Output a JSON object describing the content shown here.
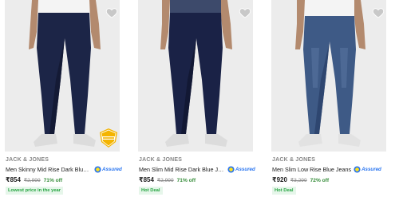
{
  "products": [
    {
      "brand": "JACK & JONES",
      "title": "Men Skinny Mid Rise Dark Blue ...",
      "price": "₹854",
      "mrp": "₹2,999",
      "discount": "71% off",
      "tag": "Lowest price in the year",
      "assured": "Assured",
      "badge_text": "BRAND AUTHORITY VALUE",
      "jeans_color": "#1c2547",
      "jeans_shade": "#141a35"
    },
    {
      "brand": "JACK & JONES",
      "title": "Men Slim Mid Rise Dark Blue Je...",
      "price": "₹854",
      "mrp": "₹2,999",
      "discount": "71% off",
      "tag": "Hot Deal",
      "assured": "Assured",
      "jeans_color": "#1a2246",
      "jeans_shade": "#121834"
    },
    {
      "brand": "JACK & JONES",
      "title": "Men Slim Low Rise Blue Jeans",
      "price": "₹920",
      "mrp": "₹3,299",
      "discount": "72% off",
      "tag": "Hot Deal",
      "assured": "Assured",
      "jeans_color": "#3e5a86",
      "jeans_shade": "#2e4670"
    }
  ],
  "colors": {
    "brand_grey": "#878787",
    "discount_green": "#388e3c",
    "tag_green": "#26a541",
    "assured_blue": "#2874f0",
    "badge_gold": "#f4b400"
  },
  "icons": [
    "heart-icon",
    "assured-icon",
    "brand-badge-icon",
    "product-image"
  ]
}
